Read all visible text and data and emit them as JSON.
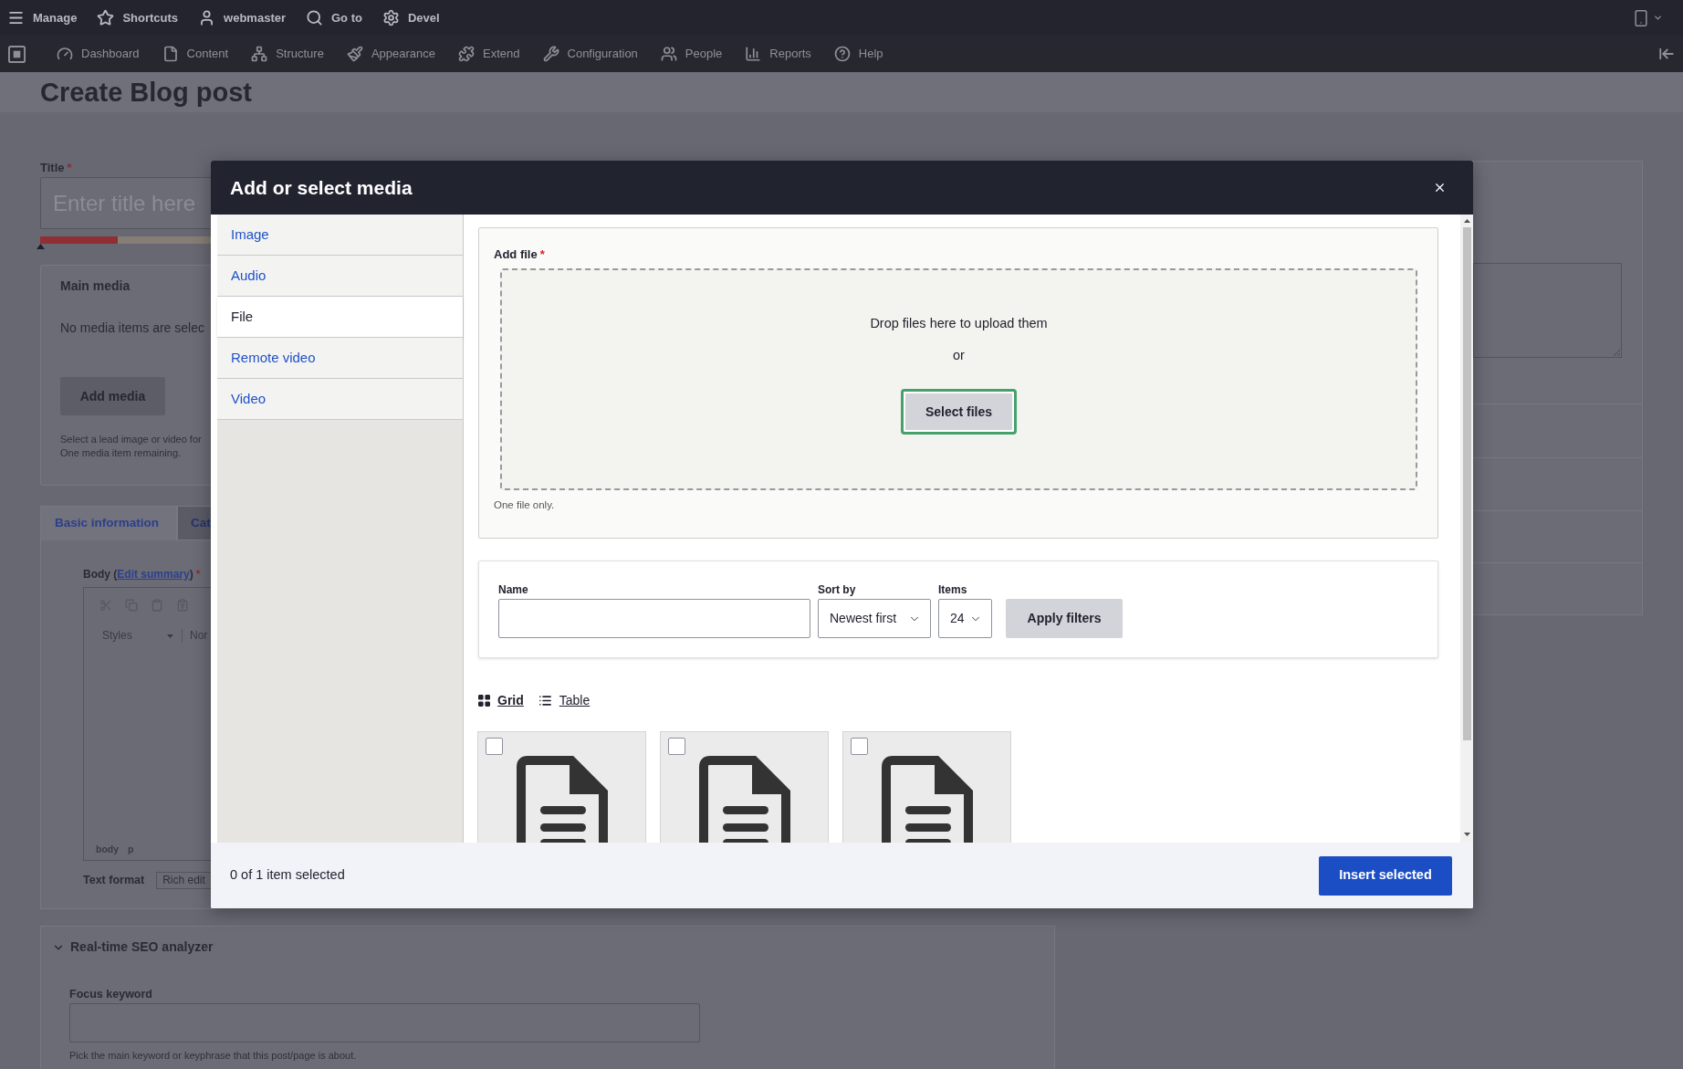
{
  "toolbar": {
    "items": [
      "Manage",
      "Shortcuts",
      "webmaster",
      "Go to",
      "Devel"
    ],
    "tray": [
      "Dashboard",
      "Content",
      "Structure",
      "Appearance",
      "Extend",
      "Configuration",
      "People",
      "Reports",
      "Help"
    ]
  },
  "page": {
    "title": "Create Blog post",
    "title_field": {
      "label": "Title",
      "required_mark": "*",
      "placeholder": "Enter title here",
      "meter": {
        "level": 0.45
      }
    },
    "main_media": {
      "title": "Main media",
      "empty_text": "No media items are selec",
      "button": "Add media",
      "help": [
        "Select a lead image or video for",
        "One media item remaining."
      ]
    },
    "tabs": [
      {
        "label": "Basic information",
        "selected": true
      },
      {
        "label": "Cat",
        "selected": false
      }
    ],
    "body": {
      "label": "Body (",
      "link": "Edit summary",
      "label_end": ")",
      "required_mark": "*",
      "style_select": "Styles",
      "format_select": "Nor",
      "path": [
        "body",
        "p"
      ],
      "text_format_label": "Text format",
      "text_format": "Rich edit"
    },
    "seo": {
      "title": "Real-time SEO analyzer",
      "expanded": true,
      "focus_label": "Focus keyword",
      "help": "Pick the main keyword or keyphrase that this post/page is about."
    }
  },
  "dialog": {
    "title": "Add or select media",
    "media_types": [
      {
        "label": "Image",
        "selected": false
      },
      {
        "label": "Audio",
        "selected": false
      },
      {
        "label": "File",
        "selected": true
      },
      {
        "label": "Remote video",
        "selected": false
      },
      {
        "label": "Video",
        "selected": false
      }
    ],
    "upload": {
      "label": "Add file",
      "required_mark": "*",
      "drop_text": "Drop files here to upload them",
      "or": "or",
      "button": "Select files",
      "help": "One file only."
    },
    "filters": {
      "name_label": "Name",
      "sort_label": "Sort by",
      "sort_value": "Newest first",
      "items_label": "Items",
      "items_value": "24",
      "apply": "Apply filters"
    },
    "views": [
      {
        "label": "Grid",
        "selected": true
      },
      {
        "label": "Table",
        "selected": false
      }
    ],
    "media": [
      {
        "checked": false
      },
      {
        "checked": false
      },
      {
        "checked": false
      }
    ],
    "status": "0 of 1 item selected",
    "insert": "Insert selected"
  }
}
